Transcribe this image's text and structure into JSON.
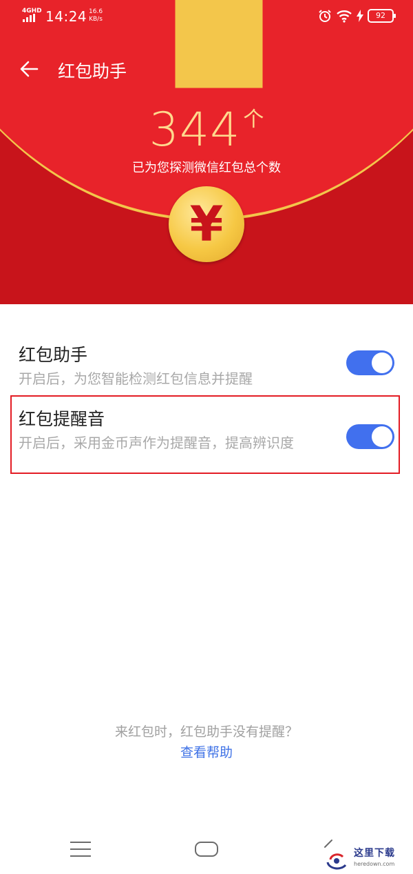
{
  "status_bar": {
    "network": "4GHD",
    "time": "14:24",
    "speed_value": "16.6",
    "speed_unit": "KB/s",
    "battery": "92",
    "icons": [
      "alarm-icon",
      "wifi-icon",
      "charging-icon",
      "battery-icon"
    ]
  },
  "header": {
    "title": "红包助手",
    "back_icon": "back-arrow-icon"
  },
  "hero": {
    "count": "344",
    "count_unit": "个",
    "caption": "已为您探测微信红包总个数",
    "coin_symbol": "¥",
    "colors": {
      "red": "#c8141b",
      "light_red": "#e8232a",
      "gold": "#f6c844"
    }
  },
  "settings": [
    {
      "title": "红包助手",
      "description": "开启后，为您智能检测红包信息并提醒",
      "enabled": true
    },
    {
      "title": "红包提醒音",
      "description": "开启后，采用金币声作为提醒音，提高辨识度",
      "enabled": true
    }
  ],
  "help": {
    "question": "来红包时，红包助手没有提醒？",
    "link": "查看帮助"
  },
  "nav_bar": {
    "icons": [
      "menu-icon",
      "home-icon",
      "back-icon"
    ]
  },
  "watermark": {
    "title": "这里下载",
    "url": "heredown.com"
  },
  "accent_color": "#4170ee"
}
